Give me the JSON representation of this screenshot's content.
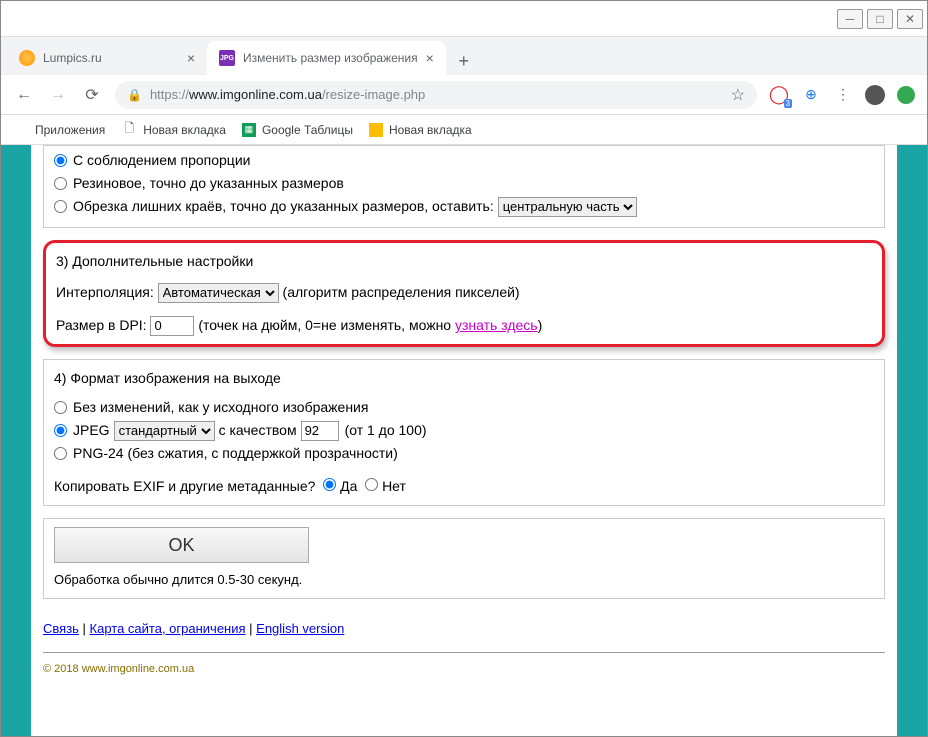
{
  "tabs": [
    {
      "title": "Lumpics.ru"
    },
    {
      "title": "Изменить размер изображения"
    }
  ],
  "url": {
    "prefix": "https://",
    "host": "www.imgonline.com.ua",
    "path": "/resize-image.php"
  },
  "ext": {
    "badge": "3"
  },
  "bookmarks": [
    "Приложения",
    "Новая вкладка",
    "Google Таблицы",
    "Новая вкладка"
  ],
  "sec2": {
    "opt1": "С соблюдением пропорции",
    "opt2": "Резиновое, точно до указанных размеров",
    "opt3": "Обрезка лишних краёв, точно до указанных размеров, оставить:",
    "crop_sel": "центральную часть"
  },
  "sec3": {
    "title": "3) Дополнительные настройки",
    "interp_label": "Интерполяция:",
    "interp_val": "Автоматическая",
    "interp_hint": "(алгоритм распределения пикселей)",
    "dpi_label": "Размер в DPI:",
    "dpi_val": "0",
    "dpi_hint": "(точек на дюйм, 0=не изменять, можно ",
    "dpi_link": "узнать здесь"
  },
  "sec4": {
    "title": "4) Формат изображения на выходе",
    "opt1": "Без изменений, как у исходного изображения",
    "jpeg": "JPEG",
    "jpeg_type": "стандартный",
    "quality_label": "с качеством",
    "quality_val": "92",
    "quality_hint": "(от 1 до 100)",
    "opt3": "PNG-24 (без сжатия, с поддержкой прозрачности)",
    "exif_label": "Копировать EXIF и другие метаданные?",
    "yes": "Да",
    "no": "Нет"
  },
  "submit": {
    "ok": "OK",
    "hint": "Обработка обычно длится 0.5-30 секунд."
  },
  "footer": {
    "links": [
      "Связь",
      "Карта сайта, ограничения",
      "English version"
    ],
    "copy": "© 2018 www.imgonline.com.ua"
  }
}
